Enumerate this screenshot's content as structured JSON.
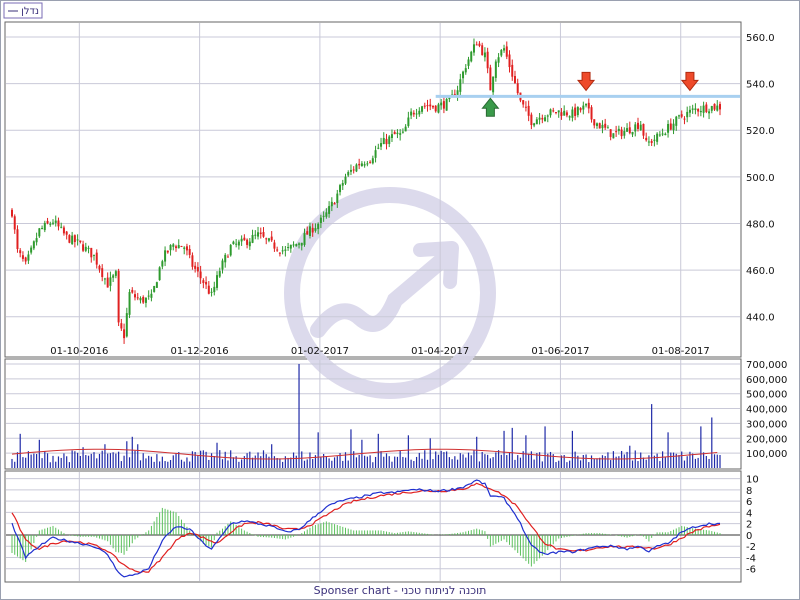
{
  "header": {
    "legend_label": "נדלן",
    "footer_text": "Sponser chart - תוכנה לניתוח טכני"
  },
  "colors": {
    "up_candle": "#2e9a2e",
    "down_candle": "#e02020",
    "resistance_line": "#a8d0f0",
    "volume_bar": "#1f2aa8",
    "volume_ma": "#d03030",
    "macd_line": "#1f2fcf",
    "signal_line": "#e02020",
    "histogram": "#5cc05c",
    "grid": "#c9c9d8",
    "watermark": "#d9d6ea"
  },
  "chart_data": [
    {
      "type": "candlestick",
      "ylim": [
        430,
        566
      ],
      "x_tick_labels": [
        "01-10-2016",
        "01-12-2016",
        "01-02-2017",
        "01-04-2017",
        "01-06-2017",
        "01-08-2017"
      ],
      "y_tick_labels": [
        "440.0",
        "460.0",
        "480.0",
        "500.0",
        "520.0",
        "540.0",
        "560.0"
      ],
      "y_ticks": [
        440,
        460,
        480,
        500,
        520,
        540,
        560
      ],
      "resistance_level": 534.5,
      "close_path": [
        [
          0,
          485
        ],
        [
          2,
          468
        ],
        [
          5,
          462
        ],
        [
          10,
          477
        ],
        [
          15,
          481
        ],
        [
          20,
          474
        ],
        [
          25,
          471
        ],
        [
          30,
          466
        ],
        [
          35,
          454
        ],
        [
          38,
          458
        ],
        [
          39,
          436
        ],
        [
          41,
          432
        ],
        [
          43,
          450
        ],
        [
          47,
          447
        ],
        [
          51,
          448
        ],
        [
          55,
          465
        ],
        [
          59,
          471
        ],
        [
          63,
          470
        ],
        [
          66,
          462
        ],
        [
          70,
          455
        ],
        [
          73,
          449
        ],
        [
          76,
          460
        ],
        [
          80,
          470
        ],
        [
          85,
          472
        ],
        [
          90,
          475
        ],
        [
          95,
          471
        ],
        [
          100,
          468
        ],
        [
          105,
          472
        ],
        [
          110,
          478
        ],
        [
          114,
          482
        ],
        [
          118,
          490
        ],
        [
          122,
          500
        ],
        [
          126,
          505
        ],
        [
          131,
          508
        ],
        [
          135,
          514
        ],
        [
          140,
          518
        ],
        [
          143,
          518
        ],
        [
          146,
          527
        ],
        [
          150,
          531
        ],
        [
          155,
          530
        ],
        [
          160,
          532
        ],
        [
          163,
          538
        ],
        [
          166,
          548
        ],
        [
          170,
          558
        ],
        [
          173,
          552
        ],
        [
          175,
          538
        ],
        [
          177,
          551
        ],
        [
          180,
          555
        ],
        [
          183,
          544
        ],
        [
          186,
          532
        ],
        [
          190,
          524
        ],
        [
          195,
          527
        ],
        [
          200,
          528
        ],
        [
          205,
          527
        ],
        [
          210,
          530
        ],
        [
          212,
          525
        ],
        [
          215,
          522
        ],
        [
          220,
          518
        ],
        [
          225,
          520
        ],
        [
          230,
          523
        ],
        [
          232,
          514
        ],
        [
          236,
          517
        ],
        [
          240,
          521
        ],
        [
          245,
          526
        ],
        [
          250,
          529
        ],
        [
          255,
          530
        ],
        [
          259,
          530
        ]
      ],
      "markers": [
        {
          "type": "buy",
          "index": 175
        },
        {
          "type": "sell",
          "index": 210
        },
        {
          "type": "sell",
          "index": 248
        }
      ]
    },
    {
      "type": "bar",
      "name": "volume",
      "ylim": [
        0,
        720000
      ],
      "y_tick_labels": [
        "700,000",
        "600,000",
        "500,000",
        "400,000",
        "300,000",
        "200,000",
        "100,000"
      ],
      "y_ticks": [
        700000,
        600000,
        500000,
        400000,
        300000,
        200000,
        100000
      ],
      "baseline": 110000,
      "spikes": [
        {
          "index": 3,
          "value": 230000
        },
        {
          "index": 10,
          "value": 190000
        },
        {
          "index": 26,
          "value": 140000
        },
        {
          "index": 34,
          "value": 160000
        },
        {
          "index": 42,
          "value": 180000
        },
        {
          "index": 44,
          "value": 210000
        },
        {
          "index": 46,
          "value": 160000
        },
        {
          "index": 75,
          "value": 170000
        },
        {
          "index": 95,
          "value": 160000
        },
        {
          "index": 105,
          "value": 700000
        },
        {
          "index": 112,
          "value": 240000
        },
        {
          "index": 124,
          "value": 260000
        },
        {
          "index": 128,
          "value": 190000
        },
        {
          "index": 134,
          "value": 230000
        },
        {
          "index": 145,
          "value": 220000
        },
        {
          "index": 153,
          "value": 200000
        },
        {
          "index": 170,
          "value": 210000
        },
        {
          "index": 180,
          "value": 250000
        },
        {
          "index": 183,
          "value": 270000
        },
        {
          "index": 188,
          "value": 220000
        },
        {
          "index": 195,
          "value": 280000
        },
        {
          "index": 205,
          "value": 250000
        },
        {
          "index": 226,
          "value": 150000
        },
        {
          "index": 234,
          "value": 430000
        },
        {
          "index": 240,
          "value": 240000
        },
        {
          "index": 252,
          "value": 280000
        },
        {
          "index": 256,
          "value": 340000
        }
      ],
      "ma_level": 110000
    },
    {
      "type": "line",
      "name": "macd",
      "ylim": [
        -8,
        11
      ],
      "y_tick_labels": [
        "10",
        "8",
        "6",
        "4",
        "2",
        "0",
        "-2",
        "-4",
        "-6"
      ],
      "y_ticks": [
        10,
        8,
        6,
        4,
        2,
        0,
        -2,
        -4,
        -6
      ],
      "macd_path": [
        [
          0,
          2
        ],
        [
          5,
          -4
        ],
        [
          10,
          -2
        ],
        [
          15,
          -0.5
        ],
        [
          20,
          -1
        ],
        [
          25,
          -1.5
        ],
        [
          30,
          -2
        ],
        [
          35,
          -3.5
        ],
        [
          38,
          -6
        ],
        [
          41,
          -7.5
        ],
        [
          45,
          -7
        ],
        [
          50,
          -6
        ],
        [
          55,
          -1
        ],
        [
          60,
          1.5
        ],
        [
          65,
          1
        ],
        [
          70,
          -1.5
        ],
        [
          73,
          -2.5
        ],
        [
          77,
          0
        ],
        [
          80,
          2
        ],
        [
          85,
          2.5
        ],
        [
          90,
          2
        ],
        [
          95,
          1.5
        ],
        [
          100,
          0.5
        ],
        [
          105,
          1
        ],
        [
          110,
          3
        ],
        [
          115,
          5
        ],
        [
          120,
          6
        ],
        [
          125,
          6.5
        ],
        [
          130,
          7
        ],
        [
          135,
          7.5
        ],
        [
          140,
          7.5
        ],
        [
          145,
          8
        ],
        [
          150,
          8
        ],
        [
          155,
          7.8
        ],
        [
          160,
          8
        ],
        [
          165,
          8.5
        ],
        [
          170,
          9.7
        ],
        [
          173,
          9
        ],
        [
          175,
          7
        ],
        [
          180,
          6.5
        ],
        [
          185,
          3
        ],
        [
          190,
          -2
        ],
        [
          195,
          -3.5
        ],
        [
          200,
          -3
        ],
        [
          205,
          -3
        ],
        [
          210,
          -2.5
        ],
        [
          215,
          -2
        ],
        [
          220,
          -2
        ],
        [
          225,
          -2.5
        ],
        [
          230,
          -2
        ],
        [
          233,
          -3
        ],
        [
          236,
          -2
        ],
        [
          240,
          -1.5
        ],
        [
          245,
          0.5
        ],
        [
          250,
          1.5
        ],
        [
          255,
          2
        ],
        [
          259,
          2
        ]
      ],
      "signal_path": [
        [
          0,
          4
        ],
        [
          5,
          -1
        ],
        [
          10,
          -2.5
        ],
        [
          15,
          -1.5
        ],
        [
          20,
          -1
        ],
        [
          25,
          -1.3
        ],
        [
          30,
          -1.8
        ],
        [
          35,
          -2.8
        ],
        [
          40,
          -5
        ],
        [
          45,
          -6.5
        ],
        [
          50,
          -6.5
        ],
        [
          55,
          -4
        ],
        [
          60,
          -1
        ],
        [
          65,
          0.5
        ],
        [
          70,
          -0.5
        ],
        [
          75,
          -1.5
        ],
        [
          80,
          0.5
        ],
        [
          85,
          2
        ],
        [
          90,
          2.2
        ],
        [
          95,
          1.8
        ],
        [
          100,
          1
        ],
        [
          105,
          1
        ],
        [
          110,
          2
        ],
        [
          115,
          3.5
        ],
        [
          120,
          5
        ],
        [
          125,
          6
        ],
        [
          130,
          6.5
        ],
        [
          135,
          7
        ],
        [
          140,
          7.3
        ],
        [
          145,
          7.6
        ],
        [
          150,
          7.8
        ],
        [
          155,
          7.8
        ],
        [
          160,
          7.9
        ],
        [
          165,
          8.2
        ],
        [
          170,
          9
        ],
        [
          175,
          8.3
        ],
        [
          180,
          7
        ],
        [
          185,
          5
        ],
        [
          190,
          1.5
        ],
        [
          195,
          -1.5
        ],
        [
          200,
          -2.6
        ],
        [
          205,
          -2.9
        ],
        [
          210,
          -2.7
        ],
        [
          215,
          -2.2
        ],
        [
          220,
          -2
        ],
        [
          225,
          -2.2
        ],
        [
          230,
          -2.1
        ],
        [
          235,
          -2.4
        ],
        [
          240,
          -1.8
        ],
        [
          245,
          -0.5
        ],
        [
          250,
          0.8
        ],
        [
          255,
          1.5
        ],
        [
          259,
          1.8
        ]
      ]
    }
  ]
}
